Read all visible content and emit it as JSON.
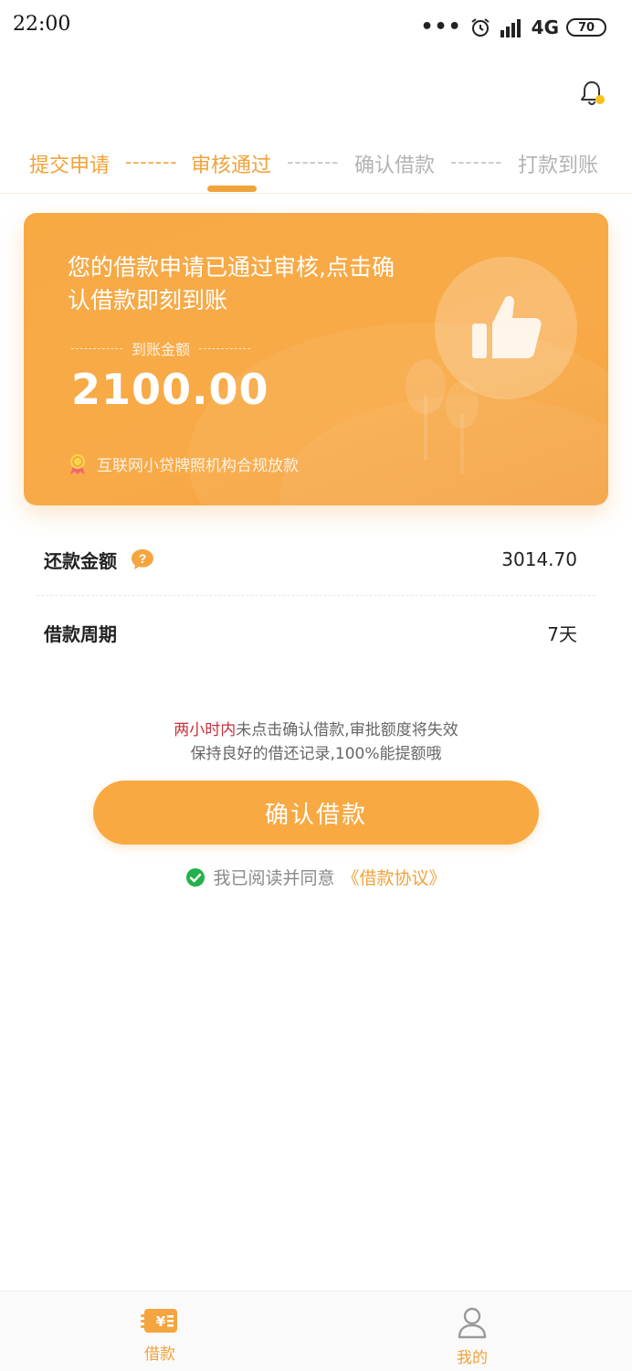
{
  "status_bar": {
    "time": "22:00",
    "dots": "•••",
    "network": "4G",
    "battery": "70"
  },
  "steps": {
    "items": [
      {
        "label": "提交申请",
        "state": "active"
      },
      {
        "label": "审核通过",
        "state": "active"
      },
      {
        "label": "确认借款",
        "state": "inactive"
      },
      {
        "label": "打款到账",
        "state": "inactive"
      }
    ],
    "separator": "-------"
  },
  "card": {
    "message": "您的借款申请已通过审核,点击确认借款即刻到账",
    "amount_label": "到账金额",
    "amount": "2100.00",
    "footer": "互联网小贷牌照机构合规放款"
  },
  "details": {
    "repay_label": "还款金额",
    "repay_value": "3014.70",
    "period_label": "借款周期",
    "period_value": "7天"
  },
  "notice": {
    "highlight": "两小时内",
    "line1_rest": "未点击确认借款,审批额度将失效",
    "line2": "保持良好的借还记录,100%能提额哦"
  },
  "confirm_button": "确认借款",
  "agreement": {
    "text": "我已阅读并同意",
    "link": "《借款协议》"
  },
  "nav": {
    "items": [
      {
        "label": "借款",
        "icon": "loan-icon"
      },
      {
        "label": "我的",
        "icon": "user-icon"
      }
    ]
  },
  "colors": {
    "accent": "#f0a33b",
    "card": "#f8aa48",
    "warning": "#c9303c",
    "check": "#22b14c"
  }
}
